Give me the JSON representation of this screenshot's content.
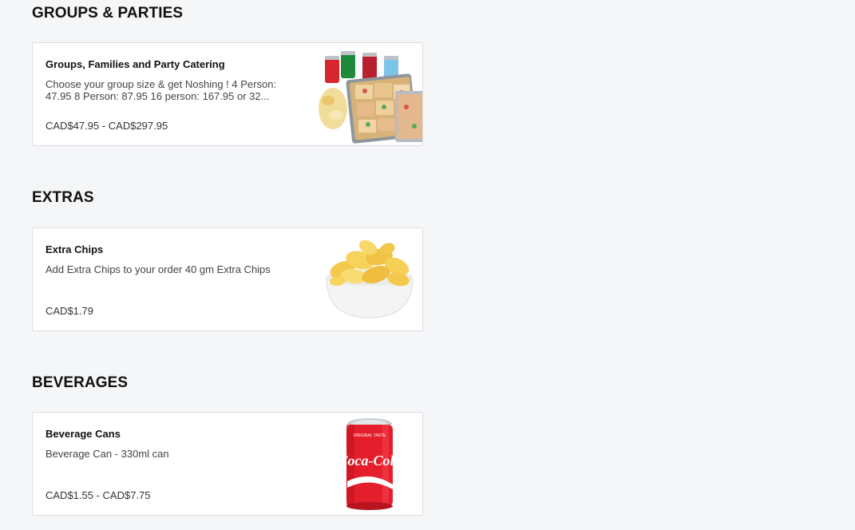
{
  "sections": [
    {
      "title": "GROUPS & PARTIES",
      "items": [
        {
          "name": "Groups, Families and Party Catering",
          "description": "Choose your group size & get Noshing ! 4 Person: 47.95 8 Person: 87.95 16 person: 167.95 or 32...",
          "price": "CAD$47.95 - CAD$297.95",
          "image_icon": "catering-platter-with-sodas"
        }
      ]
    },
    {
      "title": "EXTRAS",
      "items": [
        {
          "name": "Extra Chips",
          "description": "Add Extra Chips to your order 40 gm Extra Chips",
          "price": "CAD$1.79",
          "image_icon": "chips-bowl"
        }
      ]
    },
    {
      "title": "BEVERAGES",
      "items": [
        {
          "name": "Beverage Cans",
          "description": "Beverage Can - 330ml can",
          "price": "CAD$1.55 - CAD$7.75",
          "image_icon": "soda-can",
          "image_text": "Coca-Cola"
        }
      ]
    }
  ],
  "colors": {
    "background": "#f5f6f8",
    "card_border": "#dadde2",
    "can_red": "#e41e2b"
  }
}
